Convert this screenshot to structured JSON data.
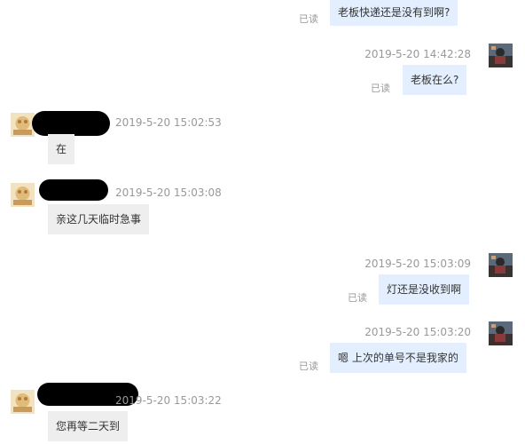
{
  "read_label": "已读",
  "messages": [
    {
      "side": "out",
      "text": "老板快递还是没有到啊?"
    },
    {
      "side": "out",
      "time": "2019-5-20 14:42:28",
      "text": "老板在么?"
    },
    {
      "side": "in",
      "time": "2019-5-20 15:02:53",
      "text": "在"
    },
    {
      "side": "in",
      "time": "2019-5-20 15:03:08",
      "text": "亲这几天临时急事"
    },
    {
      "side": "out",
      "time": "2019-5-20 15:03:09",
      "text": "灯还是没收到啊"
    },
    {
      "side": "out",
      "time": "2019-5-20 15:03:20",
      "text": "嗯 上次的单号不是我家的"
    },
    {
      "side": "in",
      "time": "2019-5-20 15:03:22",
      "text": "您再等二天到"
    }
  ],
  "colors": {
    "outgoing_bubble": "#e3efff",
    "incoming_bubble": "#eeeeee",
    "timestamp": "#999999",
    "read_label": "#9a9a9a"
  },
  "icons": {
    "self_avatar": "avatar-self-icon",
    "contact_avatar": "avatar-contact-icon",
    "redaction": "name-redaction"
  }
}
